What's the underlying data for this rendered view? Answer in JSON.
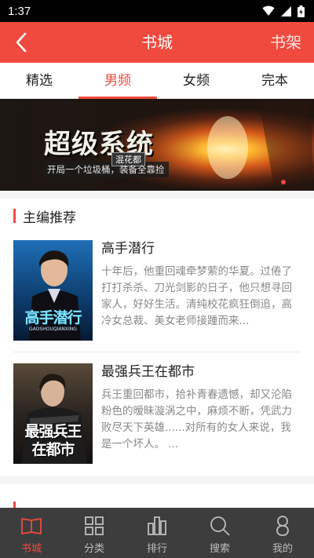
{
  "status_bar": {
    "time": "1:37"
  },
  "header": {
    "title": "书城",
    "shelf_label": "书架"
  },
  "tabs": [
    {
      "label": "精选",
      "active": false
    },
    {
      "label": "男频",
      "active": true
    },
    {
      "label": "女频",
      "active": false
    },
    {
      "label": "完本",
      "active": false
    }
  ],
  "banner": {
    "title": "超级系统",
    "subtitle_badge": "混花都",
    "tagline": "开局一个垃圾桶，装备全靠捡"
  },
  "section": {
    "title": "主编推荐",
    "books": [
      {
        "title": "高手潜行",
        "description": "十年后，他重回魂牵梦萦的华夏。过倦了打打杀杀、刀光剑影的日子，他只想寻回家人，好好生活。清纯校花疯狂倒追，高冷女总裁、美女老师接踵而来...",
        "cover_title": "高手潜行",
        "cover_sub": "GAOSHOUQIANXING"
      },
      {
        "title": "最强兵王在都市",
        "description": "兵王重回都市，拾补青春遗憾，却又沦陷粉色的暧昧漩涡之中，麻烦不断，凭武力败尽天下英雄......对所有的女人来说，我是一个坏人。 ...",
        "cover_title_line1": "最强兵王",
        "cover_title_line2": "在都市"
      }
    ]
  },
  "bottom_nav": [
    {
      "label": "书城",
      "icon": "book-open-icon",
      "active": true
    },
    {
      "label": "分类",
      "icon": "grid-icon",
      "active": false
    },
    {
      "label": "排行",
      "icon": "ranking-icon",
      "active": false
    },
    {
      "label": "搜索",
      "icon": "search-icon",
      "active": false
    },
    {
      "label": "我的",
      "icon": "person-icon",
      "active": false
    }
  ],
  "colors": {
    "accent": "#f04a3e",
    "nav_bg": "#3d3d3d",
    "muted_text": "#888888"
  }
}
